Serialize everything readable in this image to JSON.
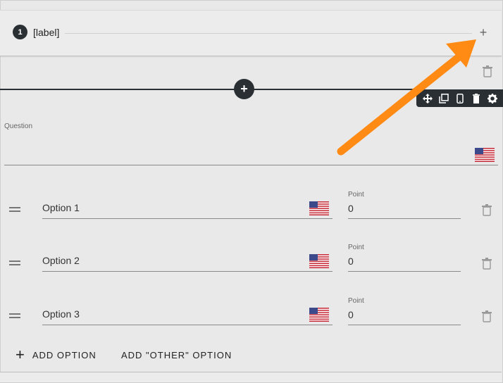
{
  "section": {
    "step_number": "1",
    "label": "[label]"
  },
  "question": {
    "label": "Question",
    "value": ""
  },
  "options": [
    {
      "text": "Option 1",
      "point_label": "Point",
      "point_value": "0"
    },
    {
      "text": "Option 2",
      "point_label": "Point",
      "point_value": "0"
    },
    {
      "text": "Option 3",
      "point_label": "Point",
      "point_value": "0"
    }
  ],
  "actions": {
    "add_option": "ADD OPTION",
    "add_other_option": "ADD \"OTHER\" OPTION"
  },
  "toolbar_icons": [
    "move-icon",
    "copy-icon",
    "mobile-icon",
    "delete-icon",
    "settings-icon"
  ],
  "colors": {
    "accent_dark": "#2a2f33",
    "annotation_arrow": "#ff8a14"
  }
}
